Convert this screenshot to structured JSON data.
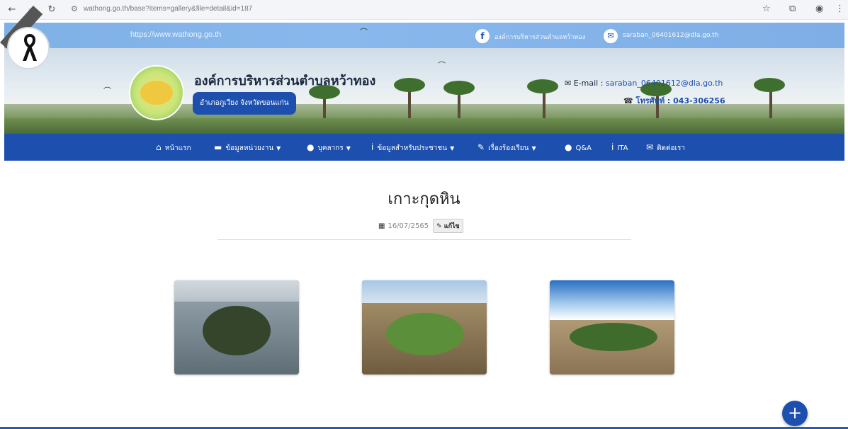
{
  "browser": {
    "url": "wathong.go.th/base?items=gallery&file=detail&id=187",
    "back_icon": "arrow-left-icon",
    "forward_icon": "arrow-right-icon",
    "reload_icon": "reload-icon"
  },
  "topbar": {
    "site_url": "https://www.wathong.go.th",
    "facebook_text": "องค์การบริหารส่วนตำบลหว้าทอง",
    "email_text": "saraban_06401612@dla.go.th"
  },
  "header": {
    "org_name": "องค์การบริหารส่วนตำบลหว้าทอง",
    "district": "อำเภอภูเวียง จังหวัดขอนแก่น",
    "email_label": "E-mail : ",
    "email_value": "saraban_06401612@dla.go.th",
    "phone_label": "โทรศัพท์ : ",
    "phone_value": "043-306256"
  },
  "nav": {
    "items": [
      {
        "label": "หน้าแรก",
        "icon": "home-icon",
        "dropdown": false
      },
      {
        "label": "ข้อมูลหน่วยงาน",
        "icon": "folder-icon",
        "dropdown": true
      },
      {
        "label": "บุคลากร",
        "icon": "user-icon",
        "dropdown": true
      },
      {
        "label": "ข้อมูลสำหรับประชาชน",
        "icon": "info-icon",
        "dropdown": true
      },
      {
        "label": "เรื่องร้องเรียน",
        "icon": "user-edit-icon",
        "dropdown": true
      },
      {
        "label": "Q&A",
        "icon": "chat-icon",
        "dropdown": false
      },
      {
        "label": "ITA",
        "icon": "info-icon",
        "dropdown": false
      },
      {
        "label": "ติดต่อเรา",
        "icon": "mail-icon",
        "dropdown": false
      }
    ]
  },
  "content": {
    "title": "เกาะกุดหิน",
    "date": "16/07/2565",
    "edit_label": "แก้ไข"
  },
  "colors": {
    "primary": "#1d4fae",
    "topbar": "#7fb0e6"
  }
}
